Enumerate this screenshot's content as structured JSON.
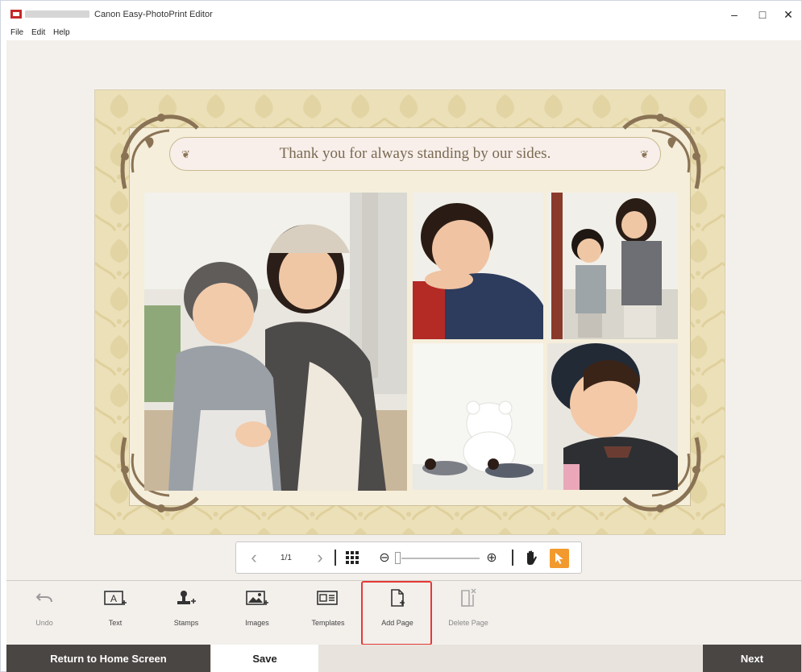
{
  "window": {
    "title": "Canon Easy-PhotoPrint Editor",
    "controls": {
      "minimize": "–",
      "maximize": "□",
      "close": "✕"
    }
  },
  "menu": {
    "items": [
      "File",
      "Edit",
      "Help"
    ]
  },
  "canvas": {
    "banner_text": "Thank you for always standing by our sides.",
    "colors": {
      "background": "#ece0b8",
      "frame": "#f5eedb",
      "ornament": "#8a7355"
    }
  },
  "navigation": {
    "prev": "‹",
    "page_indicator": "1/1",
    "next": "›",
    "zoom_out": "⊖",
    "zoom_in": "⊕"
  },
  "tools": [
    {
      "label": "Undo",
      "icon": "undo-icon",
      "enabled": false
    },
    {
      "label": "Text",
      "icon": "text-icon",
      "enabled": true
    },
    {
      "label": "Stamps",
      "icon": "stamps-icon",
      "enabled": true
    },
    {
      "label": "Images",
      "icon": "images-icon",
      "enabled": true
    },
    {
      "label": "Templates",
      "icon": "templates-icon",
      "enabled": true
    },
    {
      "label": "Add Page",
      "icon": "add-page-icon",
      "enabled": true
    },
    {
      "label": "Delete Page",
      "icon": "delete-page-icon",
      "enabled": false
    }
  ],
  "bottom": {
    "home_label": "Return to Home Screen",
    "save_label": "Save",
    "next_label": "Next"
  },
  "accent_color": "#f29a2e",
  "highlight_color": "#e53935"
}
